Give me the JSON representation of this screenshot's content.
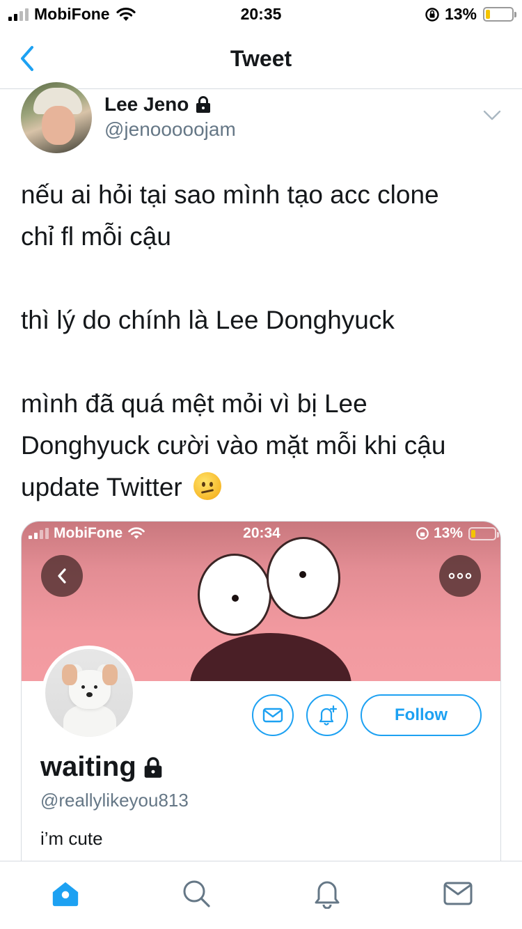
{
  "status_bar": {
    "carrier": "MobiFone",
    "time": "20:35",
    "battery": "13%"
  },
  "nav": {
    "title": "Tweet"
  },
  "tweet": {
    "author_name": "Lee Jeno",
    "author_handle": "@jenooooojam",
    "lines": [
      "nếu ai hỏi tại sao mình tạo acc clone",
      "chỉ fl mỗi cậu",
      "thì lý do chính là Lee Donghyuck",
      "mình đã quá mệt mỏi vì bị Lee",
      "Donghyuck cười vào mặt mỗi khi cậu",
      "update Twitter"
    ]
  },
  "embedded_screenshot": {
    "status_bar": {
      "carrier": "MobiFone",
      "time": "20:34",
      "battery": "13%"
    },
    "profile": {
      "name": "waiting",
      "handle": "@reallylikeyou813",
      "bio": "i’m cute",
      "follow_label": "Follow"
    }
  },
  "icons": {
    "back": "chevron-left-icon",
    "lock": "lock-icon",
    "more": "chevron-down-icon",
    "tabs": [
      "home-icon",
      "search-icon",
      "notifications-icon",
      "messages-icon"
    ]
  },
  "colors": {
    "accent": "#1da1f2",
    "text_primary": "#14171a",
    "text_secondary": "#657786",
    "banner_pink": "#f29aa0"
  }
}
